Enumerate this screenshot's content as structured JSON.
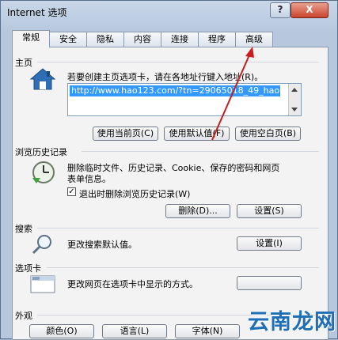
{
  "window": {
    "title": "Internet 选项",
    "help_label": "?",
    "close_label": "X"
  },
  "tabs": [
    {
      "label": "常规"
    },
    {
      "label": "安全"
    },
    {
      "label": "隐私"
    },
    {
      "label": "内容"
    },
    {
      "label": "连接"
    },
    {
      "label": "程序"
    },
    {
      "label": "高级"
    }
  ],
  "home": {
    "title": "主页",
    "desc": "若要创建主页选项卡，请在各地址行键入地址(R)。",
    "url": "http://www.hao123.com/?tn=29065018_49_hao",
    "btn_current": "使用当前页(C)",
    "btn_default": "使用默认值(F)",
    "btn_blank": "使用空白页(B)"
  },
  "history": {
    "title": "浏览历史记录",
    "desc1": "删除临时文件、历史记录、Cookie、保存的密码和网页",
    "desc2": "表单信息。",
    "checkbox_label": "退出时删除浏览历史记录(W)",
    "checkbox_mark": "✓",
    "btn_delete": "删除(D)...",
    "btn_settings": "设置(S)"
  },
  "search": {
    "title": "搜索",
    "desc": "更改搜索默认值。",
    "btn_settings": "设置(I)"
  },
  "tabsec": {
    "title": "选项卡",
    "desc": "更改网页在选项卡中显示的方式。"
  },
  "appearance": {
    "title": "外观",
    "btn_colors": "颜色(O)",
    "btn_languages": "语言(L)",
    "btn_fonts": "字体(N)"
  },
  "watermark": {
    "text": "云南龙网"
  },
  "colors": {
    "arrow": "#c81e1e",
    "selection": "#3399ff"
  }
}
